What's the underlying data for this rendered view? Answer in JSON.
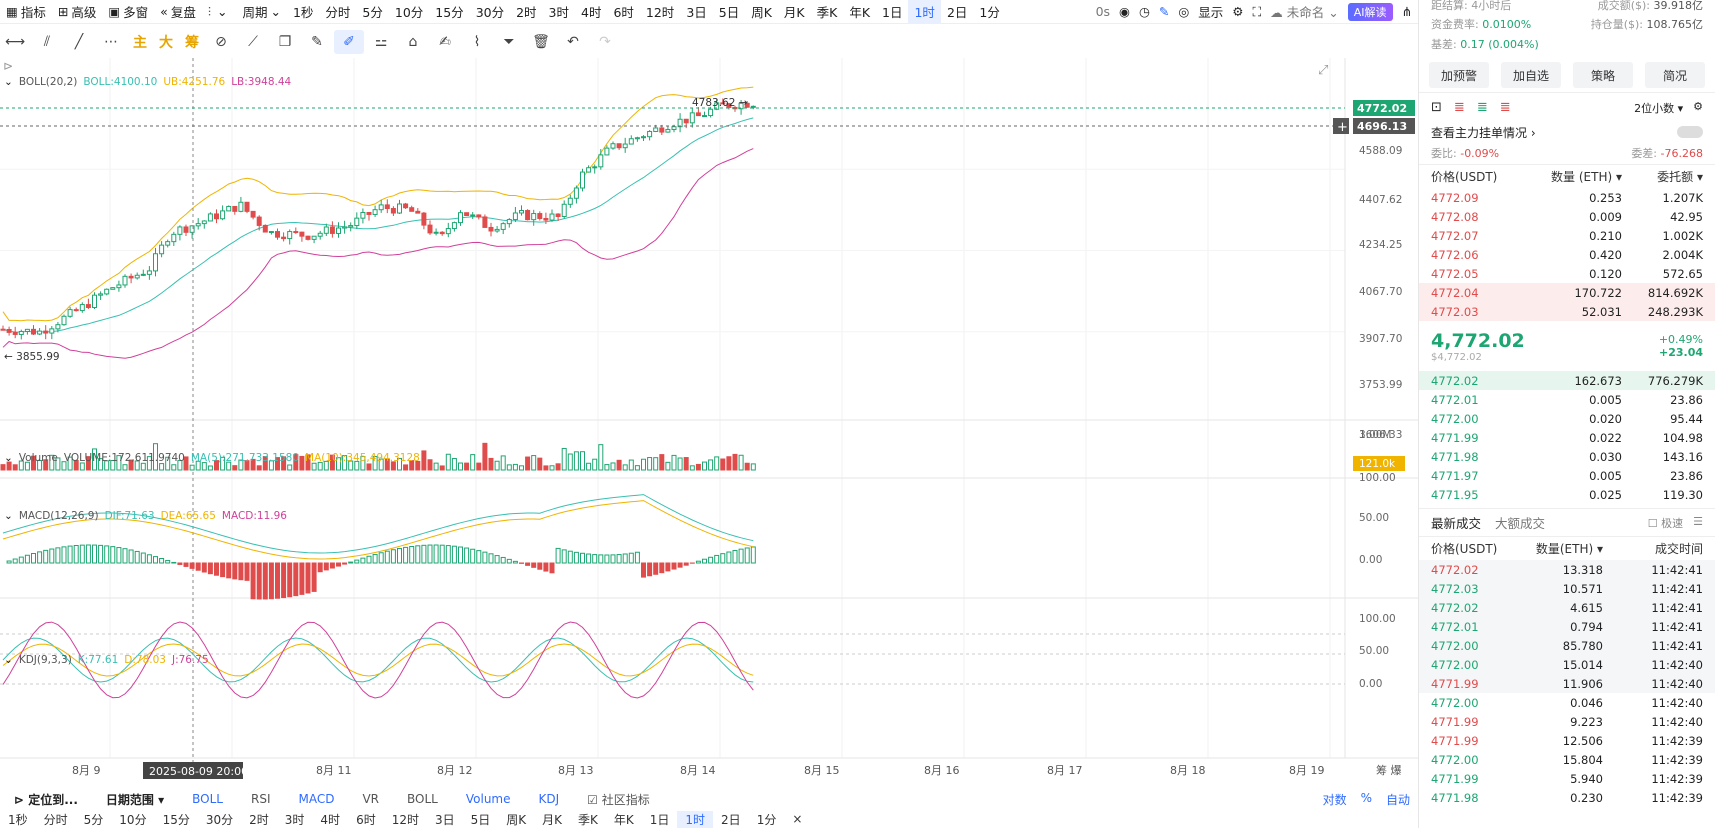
{
  "toolbar": {
    "items": [
      "指标",
      "高级",
      "多窗",
      "复盘",
      "",
      "周期",
      "1秒",
      "分时",
      "5分",
      "10分",
      "15分",
      "30分",
      "2时",
      "3时",
      "4时",
      "6时",
      "12时",
      "3日",
      "5日",
      "周K",
      "月K",
      "季K",
      "年K",
      "1日",
      "1时",
      "2日",
      "1分"
    ],
    "active_index": 24,
    "right": {
      "seconds": "0s",
      "display": "显示",
      "name": "未命名",
      "ai": "AI解读"
    }
  },
  "draw_tools": {
    "main": "主",
    "big": "大",
    "chip": "筹"
  },
  "main_chart": {
    "indicator": "BOLL(20,2)",
    "boll": "BOLL:4100.10",
    "ub": "UB:4251.76",
    "lb": "LB:3948.44",
    "high_label": "4783.62",
    "low_label": "3855.99",
    "price_tag": "4772.02",
    "cross_tag": "4696.13",
    "y_ticks": [
      "4588.09",
      "4407.62",
      "4234.25",
      "4067.70",
      "3907.70",
      "3753.99",
      "3606.33"
    ]
  },
  "volume": {
    "label": "Volume",
    "value": "VOLUME:172,611.9740",
    "ma5": "MA(5):271,733.1580",
    "ma10": "MA(10):345,494.3128",
    "y_top": "1.00M",
    "tag": "121.0k"
  },
  "macd": {
    "label": "MACD(12,26,9)",
    "dif": "DIF:71.63",
    "dea": "DEA:65.65",
    "macd": "MACD:11.96",
    "y_ticks": [
      "100.00",
      "50.00",
      "0.00"
    ]
  },
  "kdj": {
    "label": "KDJ(9,3,3)",
    "k": "K:77.61",
    "d": "D:78.03",
    "j": "J:76.75",
    "y_ticks": [
      "100.00",
      "50.00",
      "0.00"
    ]
  },
  "x_axis": {
    "labels": [
      "8月 9",
      "8月 11",
      "8月 12",
      "8月 13",
      "8月 14",
      "8月 15",
      "8月 16",
      "8月 17",
      "8月 18",
      "8月 19"
    ],
    "crosshair_label": "2025-08-09 20:00",
    "right": "筹  爆"
  },
  "bottom": {
    "items": [
      "定位到...",
      "日期范围",
      "BOLL",
      "RSI",
      "MACD",
      "VR",
      "BOLL",
      "Volume",
      "KDJ",
      "社区指标"
    ],
    "right": [
      "对数",
      "%",
      "自动"
    ],
    "periods": [
      "1秒",
      "分时",
      "5分",
      "10分",
      "15分",
      "30分",
      "2时",
      "3时",
      "4时",
      "6时",
      "12时",
      "3日",
      "5日",
      "周K",
      "月K",
      "季K",
      "年K",
      "1日",
      "1时",
      "2日",
      "1分",
      "×"
    ],
    "active_period_index": 18
  },
  "panel": {
    "settle": {
      "label": "距结算:",
      "value": "4小时后",
      "label2": "成交额($):",
      "value2": "39.918亿"
    },
    "funding": {
      "label": "资金费率:",
      "value": "0.0100%",
      "label2": "持仓量($):",
      "value2": "108.765亿"
    },
    "basis": {
      "label": "基差:",
      "value": "0.17 (0.004%)"
    },
    "buttons": [
      "加预警",
      "加自选",
      "策略",
      "简况"
    ],
    "decimals": "2位小数",
    "main_orders": "查看主力挂单情况",
    "ratio": {
      "label": "委比:",
      "value": "-0.09%",
      "label2": "委差:",
      "value2": "-76.268"
    },
    "ob_header": [
      "价格(USDT)",
      "数量 (ETH)",
      "委托额"
    ],
    "asks": [
      [
        "4772.09",
        "0.253",
        "1.207K"
      ],
      [
        "4772.08",
        "0.009",
        "42.95"
      ],
      [
        "4772.07",
        "0.210",
        "1.002K"
      ],
      [
        "4772.06",
        "0.420",
        "2.004K"
      ],
      [
        "4772.05",
        "0.120",
        "572.65"
      ],
      [
        "4772.04",
        "170.722",
        "814.692K"
      ],
      [
        "4772.03",
        "52.031",
        "248.293K"
      ]
    ],
    "last_price": "4,772.02",
    "last_usd": "$4,772.02",
    "change_pct": "+0.49%",
    "change_abs": "+23.04",
    "bids": [
      [
        "4772.02",
        "162.673",
        "776.279K"
      ],
      [
        "4772.01",
        "0.005",
        "23.86"
      ],
      [
        "4772.00",
        "0.020",
        "95.44"
      ],
      [
        "4771.99",
        "0.022",
        "104.98"
      ],
      [
        "4771.98",
        "0.030",
        "143.16"
      ],
      [
        "4771.97",
        "0.005",
        "23.86"
      ],
      [
        "4771.95",
        "0.025",
        "119.30"
      ]
    ],
    "trade_tabs": [
      "最新成交",
      "大额成交"
    ],
    "fast": "极速",
    "trade_header": [
      "价格(USDT)",
      "数量(ETH)",
      "成交时间"
    ],
    "trades": [
      [
        "4772.02",
        "13.318",
        "11:42:41",
        "red"
      ],
      [
        "4772.03",
        "10.571",
        "11:42:41",
        "green"
      ],
      [
        "4772.02",
        "4.615",
        "11:42:41",
        "green"
      ],
      [
        "4772.01",
        "0.794",
        "11:42:41",
        "green"
      ],
      [
        "4772.00",
        "85.780",
        "11:42:41",
        "green"
      ],
      [
        "4772.00",
        "15.014",
        "11:42:40",
        "green"
      ],
      [
        "4771.99",
        "11.906",
        "11:42:40",
        "red"
      ],
      [
        "4772.00",
        "0.046",
        "11:42:40",
        "green"
      ],
      [
        "4771.99",
        "9.223",
        "11:42:40",
        "red"
      ],
      [
        "4771.99",
        "12.506",
        "11:42:39",
        "red"
      ],
      [
        "4772.00",
        "15.804",
        "11:42:39",
        "green"
      ],
      [
        "4771.99",
        "5.940",
        "11:42:39",
        "green"
      ],
      [
        "4771.98",
        "0.230",
        "11:42:39",
        "green"
      ]
    ]
  },
  "colors": {
    "up": "#1ea672",
    "down": "#e04b4b",
    "accent": "#2f6bff",
    "boll_mid": "#38c0b2",
    "boll_ub": "#f0b400",
    "boll_lb": "#d0409a"
  }
}
